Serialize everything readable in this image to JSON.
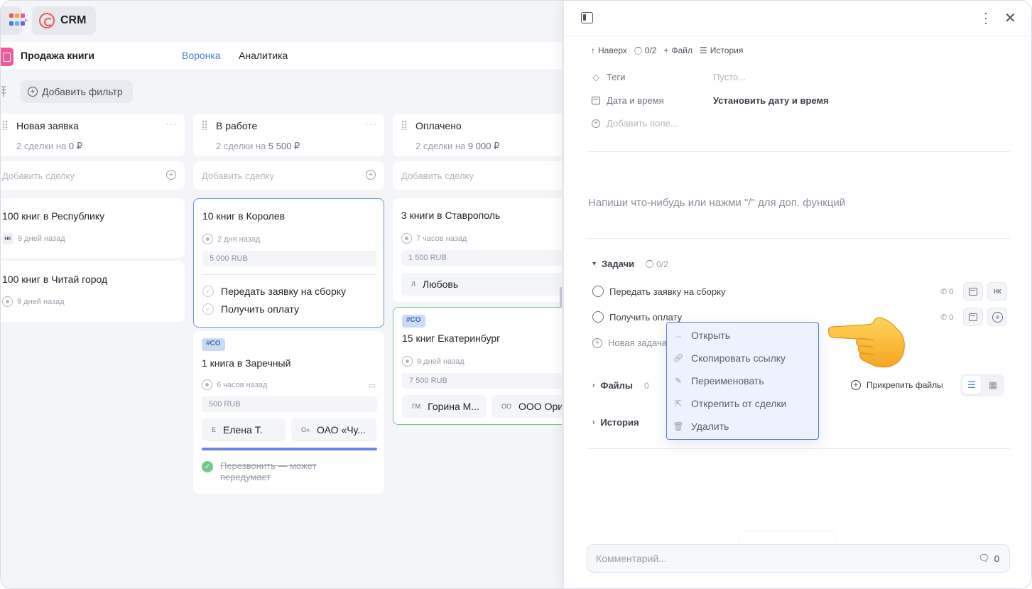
{
  "app": {
    "name": "CRM"
  },
  "project": {
    "title": "Продажа книги"
  },
  "tabs": [
    {
      "label": "Воронка"
    },
    {
      "label": "Аналитика"
    }
  ],
  "filter": {
    "add_label": "Добавить фильтр"
  },
  "columns": [
    {
      "title": "Новая заявка",
      "summary_prefix": "2 сделки на",
      "summary_amount": "0 ₽",
      "add_label": "Добавить сделку"
    },
    {
      "title": "В работе",
      "summary_prefix": "2 сделки на",
      "summary_amount": "5 500 ₽",
      "add_label": "Добавить сделку"
    },
    {
      "title": "Оплачено",
      "summary_prefix": "2 сделки на",
      "summary_amount": "9 000 ₽",
      "add_label": "Добавить сделку"
    }
  ],
  "cards": {
    "c1": {
      "title": "100 книг в Республику",
      "avatar": "НК",
      "time": "9 дней назад"
    },
    "c2": {
      "title": "100 книг в Читай город",
      "time": "9 дней назад"
    },
    "c3": {
      "title": "10 книг в Королев",
      "time": "2 дня назад",
      "price": "5 000 RUB",
      "tasks": [
        "Передать заявку на сборку",
        "Получить оплату"
      ]
    },
    "c4": {
      "tag": "#CO",
      "title": "1 книга в Заречный",
      "time": "6 часов назад",
      "price": "500 RUB",
      "person1_initial": "Е",
      "person1": "Елена Т.",
      "person2_initial": "О«",
      "person2": "ОАО «Чу...",
      "done_task": "Перезвонить — может передумает"
    },
    "c5": {
      "title": "3 книги в Ставрополь",
      "time": "7 часов назад",
      "price": "1 500 RUB",
      "person_initial": "Л",
      "person": "Любовь"
    },
    "c6": {
      "tag": "#CO",
      "title": "15 книг Екатеринбург",
      "time": "9 дней назад",
      "price": "7 500 RUB",
      "person1_initial": "ГМ",
      "person1": "Горина М...",
      "person2_initial": "ОО",
      "person2": "ООО Ори"
    }
  },
  "panel": {
    "actions": {
      "up": "Наверх",
      "progress": "0/2",
      "file": "Файл",
      "history": "История"
    },
    "fields": {
      "tags_label": "Теги",
      "tags_value": "Пусто...",
      "date_label": "Дата и время",
      "date_value": "Установить дату и время",
      "add_field": "Добавить поле..."
    },
    "editor_placeholder": "Напиши что-нибудь или нажми \"/\" для доп. функций",
    "tasks": {
      "title": "Задачи",
      "progress": "0/2",
      "items": [
        {
          "label": "Передать заявку на сборку",
          "calls": "0",
          "assignee": "НК"
        },
        {
          "label": "Получить оплату",
          "calls": "0"
        }
      ],
      "new_task": "Новая задача"
    },
    "files": {
      "title": "Файлы",
      "count": "0",
      "attach": "Прикрепить файлы"
    },
    "history": {
      "title": "История"
    },
    "comment": {
      "placeholder": "Комментарий...",
      "count": "0"
    }
  },
  "context_menu": [
    {
      "label": "Открыть",
      "icon": "arrow-right-icon"
    },
    {
      "label": "Скопировать ссылку",
      "icon": "link-icon"
    },
    {
      "label": "Переименовать",
      "icon": "edit-icon"
    },
    {
      "label": "Открепить от сделки",
      "icon": "detach-icon"
    },
    {
      "label": "Удалить",
      "icon": "trash-icon"
    }
  ],
  "colors": {
    "accent": "#4a7bd8",
    "menu_border": "#5b7fe0",
    "menu_bg": "#eef2ff",
    "done_green": "#6fc98a",
    "project_icon": "#ef5a9a"
  }
}
